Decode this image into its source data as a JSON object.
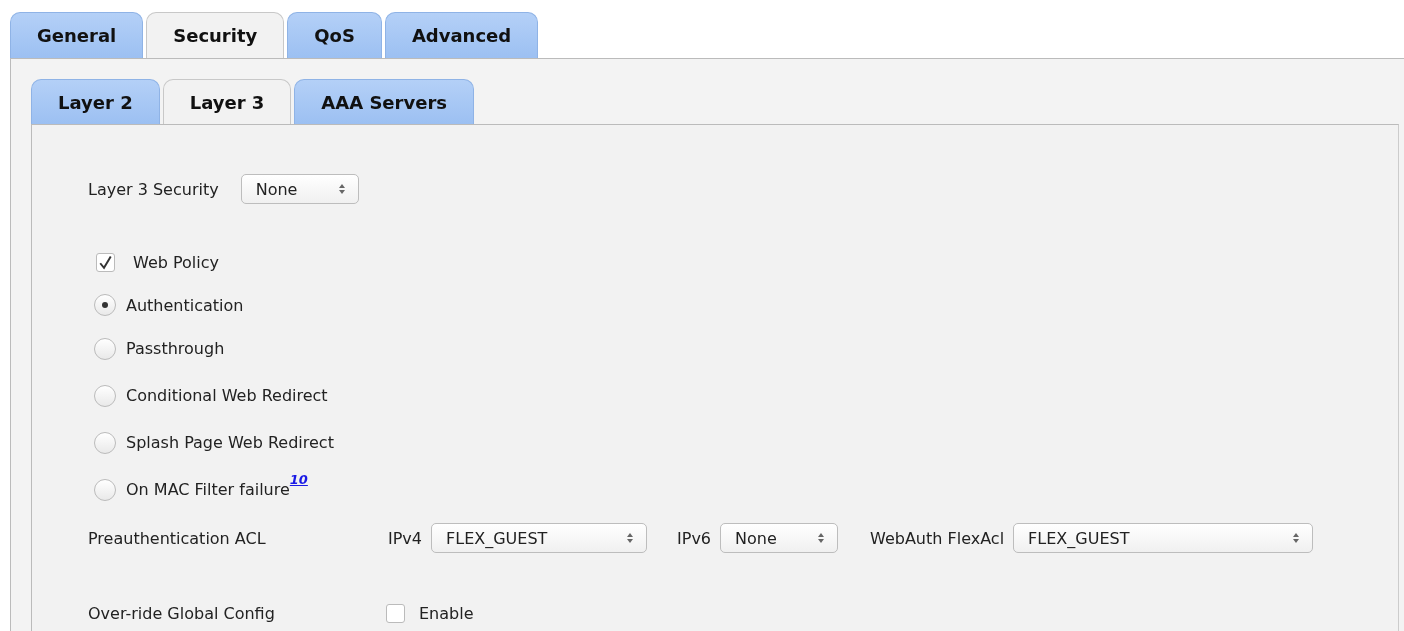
{
  "tabs": [
    {
      "label": "General",
      "selected": false
    },
    {
      "label": "Security",
      "selected": true
    },
    {
      "label": "QoS",
      "selected": false
    },
    {
      "label": "Advanced",
      "selected": false
    }
  ],
  "subtabs": [
    {
      "label": "Layer 2",
      "selected": false
    },
    {
      "label": "Layer 3",
      "selected": true
    },
    {
      "label": "AAA Servers",
      "selected": false
    }
  ],
  "layer3_security": {
    "label": "Layer 3 Security",
    "value": "None"
  },
  "web_policy": {
    "label": "Web Policy",
    "checked": true
  },
  "web_policy_options": [
    {
      "label": "Authentication",
      "selected": true
    },
    {
      "label": "Passthrough",
      "selected": false
    },
    {
      "label": "Conditional Web Redirect",
      "selected": false
    },
    {
      "label": "Splash Page Web Redirect",
      "selected": false
    },
    {
      "label": "On MAC Filter failure",
      "selected": false,
      "footnote": "10"
    }
  ],
  "preauth_acl": {
    "label": "Preauthentication ACL",
    "selects": [
      {
        "label": "IPv4",
        "value": "FLEX_GUEST"
      },
      {
        "label": "IPv6",
        "value": "None"
      },
      {
        "label": "WebAuth FlexAcl",
        "value": "FLEX_GUEST"
      }
    ]
  },
  "override": {
    "label": "Over-ride Global Config",
    "option": "Enable",
    "checked": false
  }
}
